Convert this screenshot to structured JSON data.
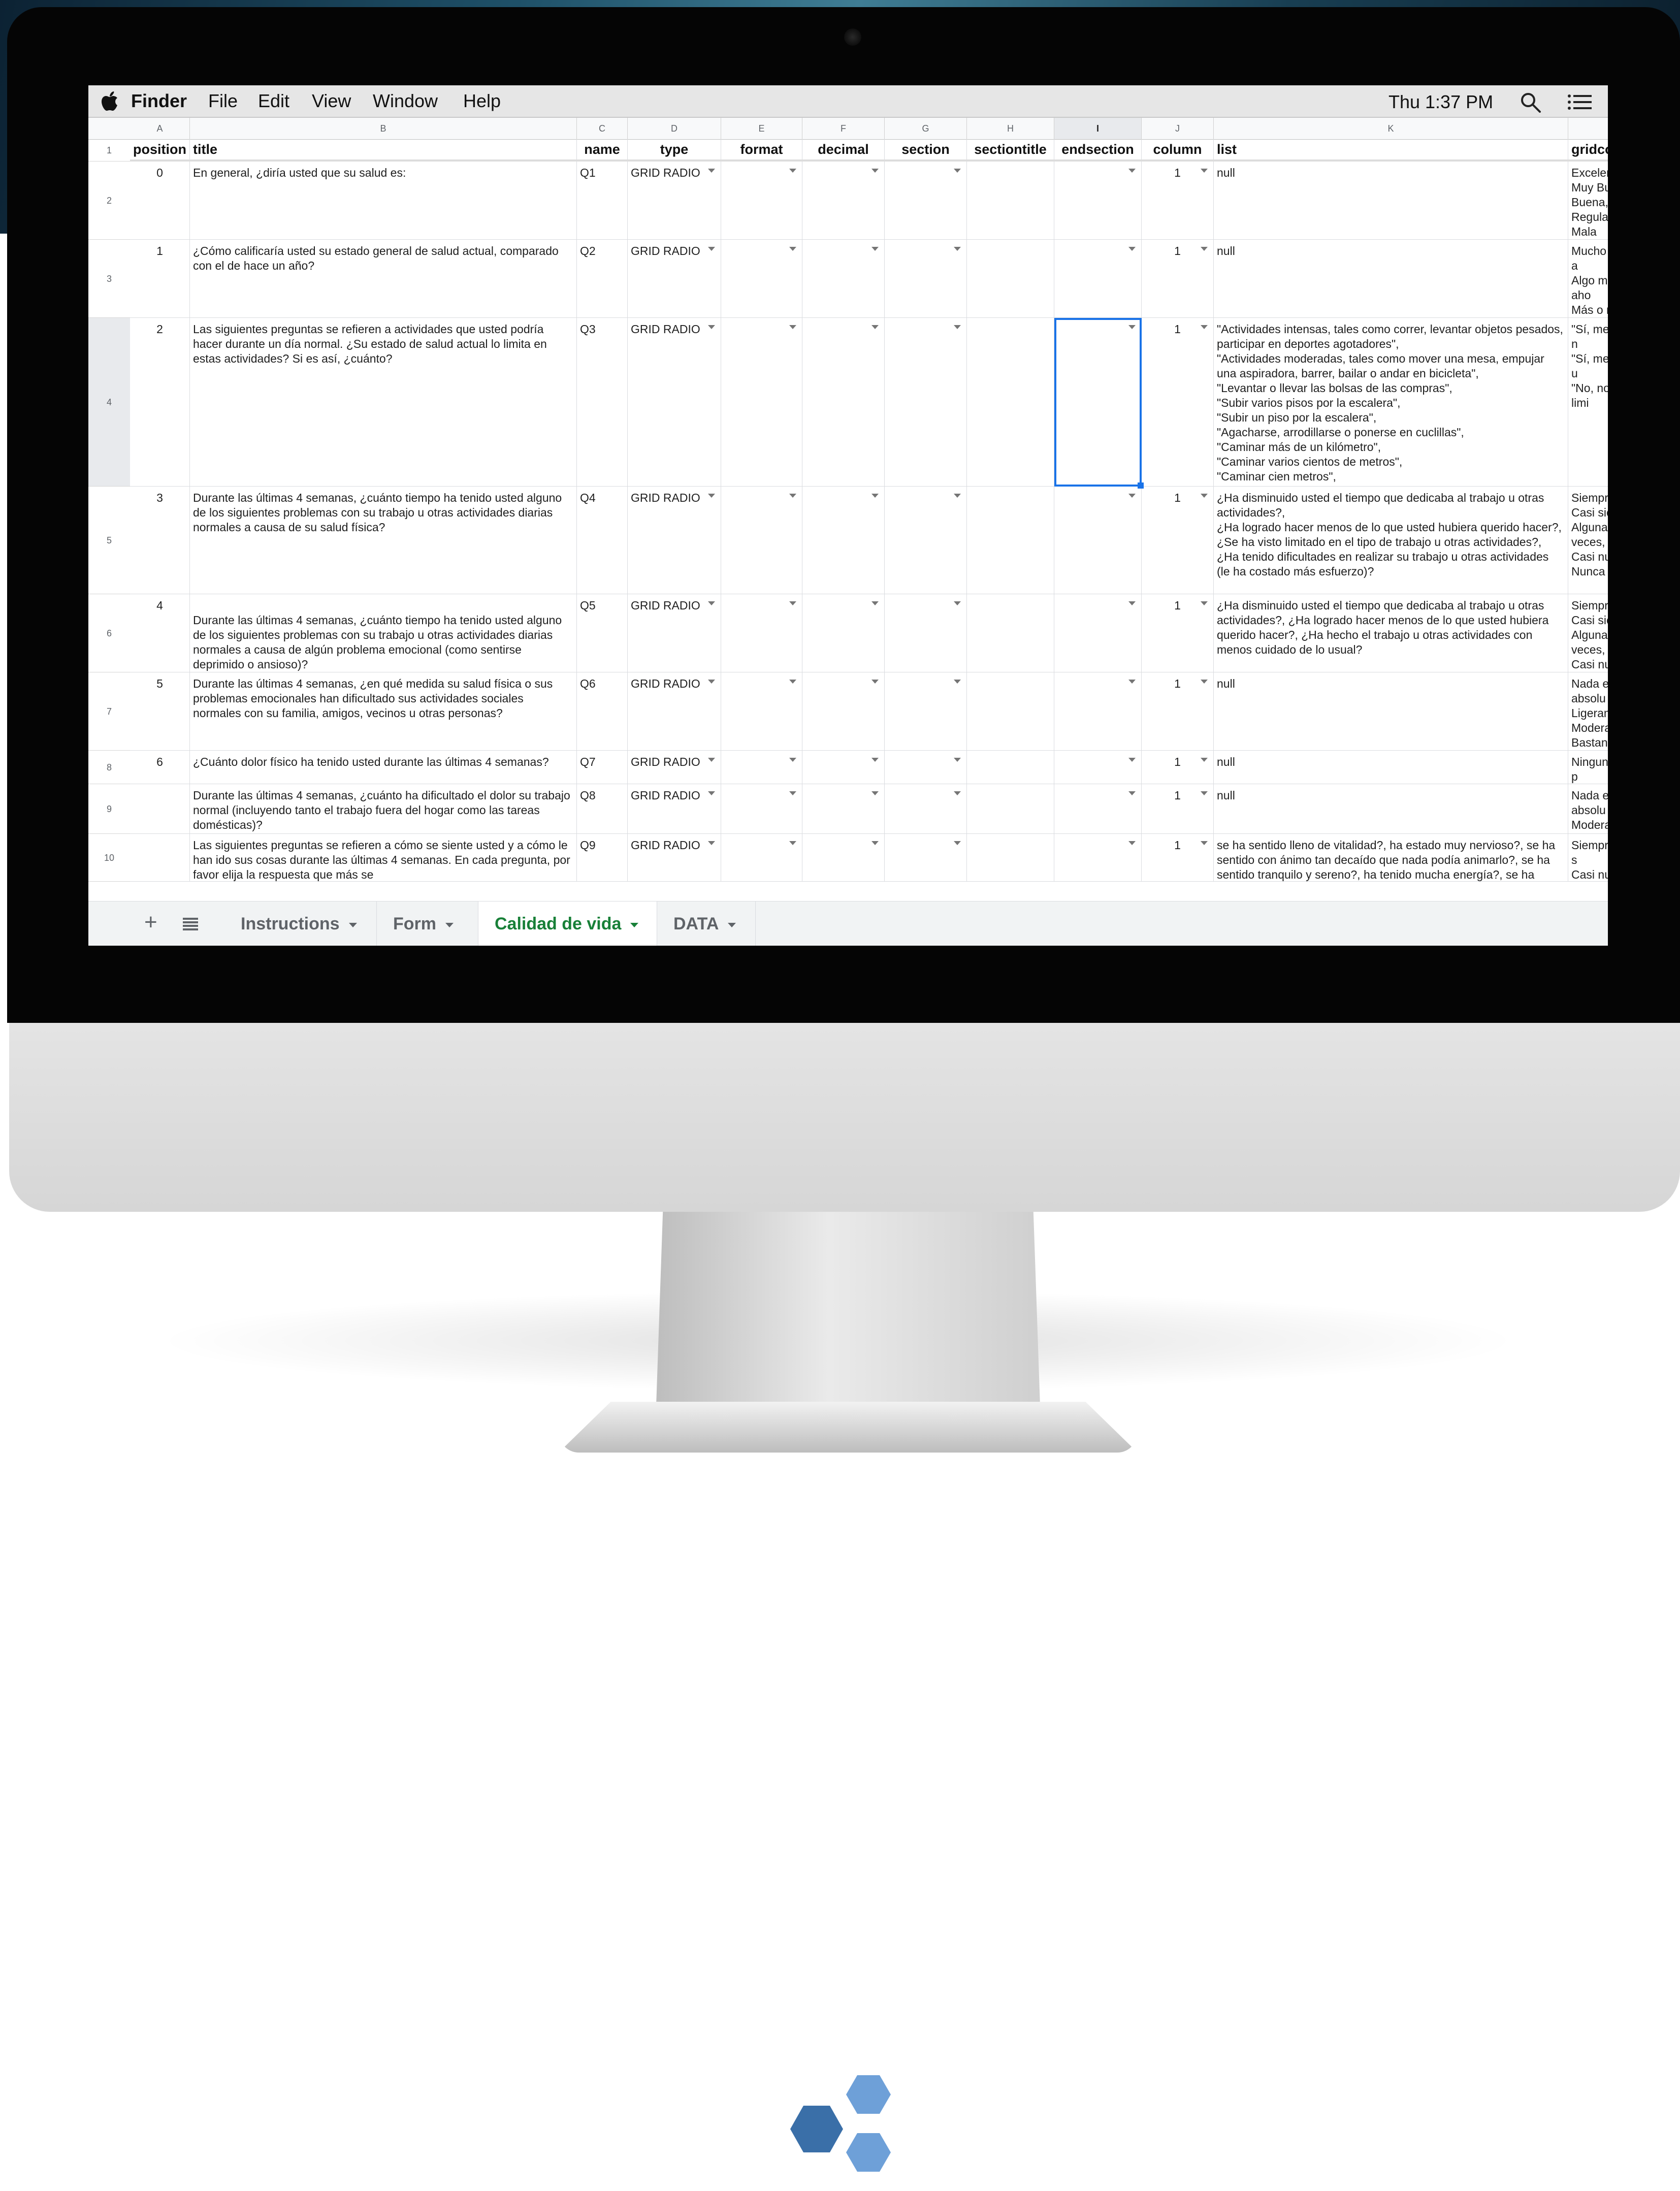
{
  "menubar": {
    "app": "Finder",
    "items": [
      "File",
      "Edit",
      "View",
      "Window",
      "Help"
    ],
    "clock": "Thu 1:37 PM"
  },
  "sheet": {
    "column_letters": [
      "A",
      "B",
      "C",
      "D",
      "E",
      "F",
      "G",
      "H",
      "I",
      "J",
      "K",
      ""
    ],
    "row_numbers": [
      "1",
      "2",
      "3",
      "4",
      "5",
      "6",
      "7",
      "8",
      "9",
      "10"
    ],
    "headers": [
      "position",
      "title",
      "name",
      "type",
      "format",
      "decimal",
      "section",
      "sectiontitle",
      "endsection",
      "column",
      "list",
      "gridcolumn"
    ],
    "rows": [
      {
        "position": "0",
        "title": "En general, ¿diría usted que su salud es:",
        "name": "Q1",
        "type": "GRID RADIO",
        "column": "1",
        "list": "null",
        "gridcolumn": "Excelente,\nMuy Buena,\nBuena,\nRegular,\nMala"
      },
      {
        "position": "1",
        "title": "¿Cómo calificaría usted su estado general de salud actual, comparado con el de hace un año?",
        "name": "Q2",
        "type": "GRID RADIO",
        "column": "1",
        "list": "null",
        "gridcolumn": "Mucho mejor a\nAlgo mejor aho\nMás o menos i\nAlgo peor ahor\nMucho peor ah"
      },
      {
        "position": "2",
        "title": "Las siguientes preguntas se refieren a actividades que usted podría hacer durante un día normal. ¿Su estado de salud actual lo limita en estas actividades? Si es así, ¿cuánto?",
        "name": "Q3",
        "type": "GRID RADIO",
        "column": "1",
        "list": "\"Actividades intensas, tales como correr, levantar objetos pesados, participar en deportes agotadores\",\n\"Actividades moderadas, tales como mover una mesa, empujar una aspiradora, barrer, bailar o andar en bicicleta\",\n\"Levantar o llevar las bolsas de las compras\",\n\"Subir varios pisos por la escalera\",\n\"Subir un piso por la escalera\",\n\"Agacharse, arrodillarse o ponerse en cuclillas\",\n\"Caminar más de un kilómetro\",\n\"Caminar varios cientos de metros\",\n\"Caminar cien metros\",",
        "gridcolumn": "\"Sí, me limita n\n\"Sí, me limita u\n\"No, no me limi"
      },
      {
        "position": "3",
        "title": "Durante las últimas 4 semanas, ¿cuánto tiempo ha tenido usted alguno de los siguientes problemas con su trabajo u otras actividades diarias normales a causa de su salud física?",
        "name": "Q4",
        "type": "GRID RADIO",
        "column": "1",
        "list": "¿Ha disminuido usted el tiempo que dedicaba al trabajo u otras actividades?,\n¿Ha logrado hacer menos de lo que usted hubiera querido hacer?,\n¿Se ha visto limitado en el tipo de trabajo u otras actividades?,\n¿Ha tenido dificultades en realizar su trabajo u otras actividades (le ha costado más esfuerzo)?",
        "gridcolumn": "Siempre,\nCasi siempre,\nAlgunas veces,\nCasi nunca,\nNunca"
      },
      {
        "position": "4",
        "title": "\nDurante las últimas 4 semanas, ¿cuánto tiempo ha tenido usted alguno de los siguientes problemas con su trabajo u otras actividades diarias normales a causa de algún problema emocional (como sentirse deprimido o ansioso)?",
        "name": "Q5",
        "type": "GRID RADIO",
        "column": "1",
        "list": "¿Ha disminuido usted el tiempo que dedicaba al trabajo u otras actividades?, ¿Ha logrado hacer menos de lo que usted hubiera querido hacer?, ¿Ha hecho el trabajo u otras actividades con menos cuidado de lo usual?",
        "gridcolumn": "Siempre,\nCasi siempre,\nAlgunas veces,\nCasi nunca,\nNunca"
      },
      {
        "position": "5",
        "title": "Durante las últimas 4 semanas, ¿en qué medida su salud física o sus problemas emocionales han dificultado sus actividades sociales normales con su familia, amigos, vecinos u otras personas?",
        "name": "Q6",
        "type": "GRID RADIO",
        "column": "1",
        "list": "null",
        "gridcolumn": "Nada en absolu\nLigeramente,\nModeradament\nBastante,\nExtremadamen"
      },
      {
        "position": "6",
        "title": "¿Cuánto dolor físico ha tenido usted durante las últimas 4 semanas?",
        "name": "Q7",
        "type": "GRID RADIO",
        "column": "1",
        "list": "null",
        "gridcolumn": "Ninguno, Muy p\nMucho, Muchís"
      },
      {
        "position": "",
        "title": "Durante las últimas 4 semanas, ¿cuánto ha dificultado el dolor su trabajo normal (incluyendo tanto el trabajo fuera del hogar como las tareas domésticas)?",
        "name": "Q8",
        "type": "GRID RADIO",
        "column": "1",
        "list": "null",
        "gridcolumn": "Nada en absolu\nModeradament\nExtremadamen"
      },
      {
        "position": "",
        "title": "Las siguientes preguntas se refieren a cómo se siente usted y a cómo le han ido sus cosas durante las últimas 4 semanas. En cada pregunta, por favor elija la respuesta que más se",
        "name": "Q9",
        "type": "GRID RADIO",
        "column": "1",
        "list": "se ha sentido lleno de vitalidad?, ha estado muy nervioso?, se ha sentido con ánimo tan decaído que nada podía animarlo?, se ha sentido tranquilo y sereno?, ha tenido mucha energía?, se ha",
        "gridcolumn": "Siempre, Casi s\nCasi nunca, Nu"
      }
    ]
  },
  "tabs": {
    "items": [
      {
        "label": "Instructions",
        "active": false
      },
      {
        "label": "Form",
        "active": false
      },
      {
        "label": "Calidad de vida",
        "active": true
      },
      {
        "label": "DATA",
        "active": false
      }
    ]
  },
  "colors": {
    "accent": "#1a73e8",
    "active_tab": "#188038",
    "logo_dark": "#3a6fa8",
    "logo_light": "#6ea0d8"
  }
}
